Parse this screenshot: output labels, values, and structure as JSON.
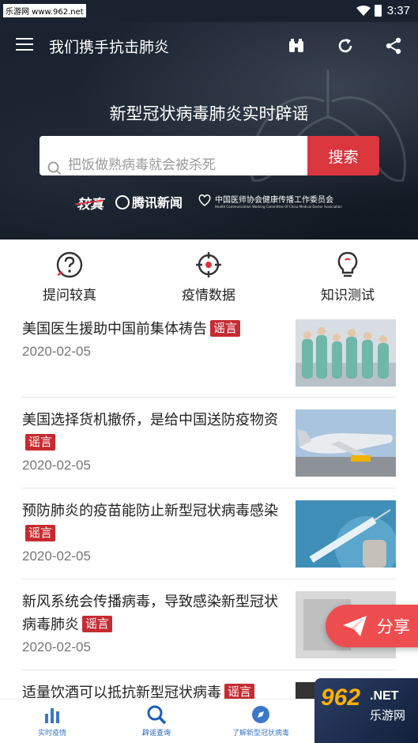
{
  "status_bar": {
    "watermark": "乐游网 www.962.net",
    "time": "3:37"
  },
  "toolbar": {
    "title": "我们携手抗击肺炎",
    "icons": [
      "menu-icon",
      "binoculars-icon",
      "refresh-icon",
      "share-icon"
    ]
  },
  "hero": {
    "title": "新型冠状病毒肺炎实时辟谣",
    "search_placeholder": "把饭做熟病毒就会被杀死",
    "search_button": "搜索",
    "partners": {
      "jiaozhen": "较真",
      "tencent": "腾讯新闻",
      "association_cn": "中国医师协会健康传播工作委员会",
      "association_en": "Health Communication Working Committee Of China Medical Doctor Association"
    }
  },
  "features": [
    {
      "label": "提问较真",
      "icon": "question-icon"
    },
    {
      "label": "疫情数据",
      "icon": "crosshair-icon"
    },
    {
      "label": "知识测试",
      "icon": "lightbulb-icon"
    }
  ],
  "news": [
    {
      "title": "美国医生援助中国前集体祷告",
      "tag": "谣言",
      "date": "2020-02-05",
      "thumb": "doctors-praying-photo"
    },
    {
      "title": "美国选择货机撤侨，是给中国送防疫物资",
      "tag": "谣言",
      "date": "2020-02-05",
      "thumb": "cargo-plane-photo"
    },
    {
      "title": "预防肺炎的疫苗能防止新型冠状病毒感染",
      "tag": "谣言",
      "date": "2020-02-05",
      "thumb": "vaccine-syringe-photo"
    },
    {
      "title": "新风系统会传播病毒，导致感染新型冠状病毒肺炎",
      "tag": "谣言",
      "date": "2020-02-05",
      "thumb": "ventilation-photo"
    },
    {
      "title": "适量饮酒可以抵抗新型冠状病毒",
      "tag": "谣言",
      "date": "",
      "thumb": "drink-photo"
    }
  ],
  "share_float": {
    "label": "分享"
  },
  "bottom_nav": [
    {
      "label": "实时疫情",
      "icon": "bar-chart-icon"
    },
    {
      "label": "辟谣查询",
      "icon": "search-icon"
    },
    {
      "label": "了解新型冠状病毒",
      "icon": "compass-icon"
    }
  ],
  "watermark_962": {
    "big": "962",
    "net": ".NET",
    "cn": "乐游网"
  },
  "colors": {
    "accent_red": "#d9363e",
    "nav_blue": "#3b78c9",
    "header_dark": "#1a2230"
  }
}
